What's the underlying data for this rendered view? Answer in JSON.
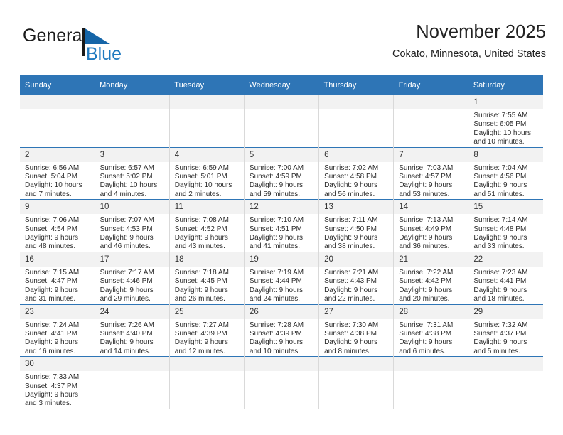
{
  "brand": {
    "name_line1": "General",
    "name_line2": "Blue",
    "logo_icon": "blue-triangle-flag-icon",
    "color_dark": "#1a1a1a",
    "color_blue": "#1f7ac0"
  },
  "header": {
    "title": "November 2025",
    "subtitle": "Cokato, Minnesota, United States"
  },
  "theme": {
    "header_bar": "#2e75b6",
    "date_band": "#f2f2f2",
    "row_divider": "#2e75b6",
    "cell_divider": "#d9d9d9"
  },
  "weekday_headers": [
    "Sunday",
    "Monday",
    "Tuesday",
    "Wednesday",
    "Thursday",
    "Friday",
    "Saturday"
  ],
  "weeks": [
    [
      {
        "day": "",
        "empty": true
      },
      {
        "day": "",
        "empty": true
      },
      {
        "day": "",
        "empty": true
      },
      {
        "day": "",
        "empty": true
      },
      {
        "day": "",
        "empty": true
      },
      {
        "day": "",
        "empty": true
      },
      {
        "day": "1",
        "sunrise": "Sunrise: 7:55 AM",
        "sunset": "Sunset: 6:05 PM",
        "daylight1": "Daylight: 10 hours",
        "daylight2": "and 10 minutes."
      }
    ],
    [
      {
        "day": "2",
        "sunrise": "Sunrise: 6:56 AM",
        "sunset": "Sunset: 5:04 PM",
        "daylight1": "Daylight: 10 hours",
        "daylight2": "and 7 minutes."
      },
      {
        "day": "3",
        "sunrise": "Sunrise: 6:57 AM",
        "sunset": "Sunset: 5:02 PM",
        "daylight1": "Daylight: 10 hours",
        "daylight2": "and 4 minutes."
      },
      {
        "day": "4",
        "sunrise": "Sunrise: 6:59 AM",
        "sunset": "Sunset: 5:01 PM",
        "daylight1": "Daylight: 10 hours",
        "daylight2": "and 2 minutes."
      },
      {
        "day": "5",
        "sunrise": "Sunrise: 7:00 AM",
        "sunset": "Sunset: 4:59 PM",
        "daylight1": "Daylight: 9 hours",
        "daylight2": "and 59 minutes."
      },
      {
        "day": "6",
        "sunrise": "Sunrise: 7:02 AM",
        "sunset": "Sunset: 4:58 PM",
        "daylight1": "Daylight: 9 hours",
        "daylight2": "and 56 minutes."
      },
      {
        "day": "7",
        "sunrise": "Sunrise: 7:03 AM",
        "sunset": "Sunset: 4:57 PM",
        "daylight1": "Daylight: 9 hours",
        "daylight2": "and 53 minutes."
      },
      {
        "day": "8",
        "sunrise": "Sunrise: 7:04 AM",
        "sunset": "Sunset: 4:56 PM",
        "daylight1": "Daylight: 9 hours",
        "daylight2": "and 51 minutes."
      }
    ],
    [
      {
        "day": "9",
        "sunrise": "Sunrise: 7:06 AM",
        "sunset": "Sunset: 4:54 PM",
        "daylight1": "Daylight: 9 hours",
        "daylight2": "and 48 minutes."
      },
      {
        "day": "10",
        "sunrise": "Sunrise: 7:07 AM",
        "sunset": "Sunset: 4:53 PM",
        "daylight1": "Daylight: 9 hours",
        "daylight2": "and 46 minutes."
      },
      {
        "day": "11",
        "sunrise": "Sunrise: 7:08 AM",
        "sunset": "Sunset: 4:52 PM",
        "daylight1": "Daylight: 9 hours",
        "daylight2": "and 43 minutes."
      },
      {
        "day": "12",
        "sunrise": "Sunrise: 7:10 AM",
        "sunset": "Sunset: 4:51 PM",
        "daylight1": "Daylight: 9 hours",
        "daylight2": "and 41 minutes."
      },
      {
        "day": "13",
        "sunrise": "Sunrise: 7:11 AM",
        "sunset": "Sunset: 4:50 PM",
        "daylight1": "Daylight: 9 hours",
        "daylight2": "and 38 minutes."
      },
      {
        "day": "14",
        "sunrise": "Sunrise: 7:13 AM",
        "sunset": "Sunset: 4:49 PM",
        "daylight1": "Daylight: 9 hours",
        "daylight2": "and 36 minutes."
      },
      {
        "day": "15",
        "sunrise": "Sunrise: 7:14 AM",
        "sunset": "Sunset: 4:48 PM",
        "daylight1": "Daylight: 9 hours",
        "daylight2": "and 33 minutes."
      }
    ],
    [
      {
        "day": "16",
        "sunrise": "Sunrise: 7:15 AM",
        "sunset": "Sunset: 4:47 PM",
        "daylight1": "Daylight: 9 hours",
        "daylight2": "and 31 minutes."
      },
      {
        "day": "17",
        "sunrise": "Sunrise: 7:17 AM",
        "sunset": "Sunset: 4:46 PM",
        "daylight1": "Daylight: 9 hours",
        "daylight2": "and 29 minutes."
      },
      {
        "day": "18",
        "sunrise": "Sunrise: 7:18 AM",
        "sunset": "Sunset: 4:45 PM",
        "daylight1": "Daylight: 9 hours",
        "daylight2": "and 26 minutes."
      },
      {
        "day": "19",
        "sunrise": "Sunrise: 7:19 AM",
        "sunset": "Sunset: 4:44 PM",
        "daylight1": "Daylight: 9 hours",
        "daylight2": "and 24 minutes."
      },
      {
        "day": "20",
        "sunrise": "Sunrise: 7:21 AM",
        "sunset": "Sunset: 4:43 PM",
        "daylight1": "Daylight: 9 hours",
        "daylight2": "and 22 minutes."
      },
      {
        "day": "21",
        "sunrise": "Sunrise: 7:22 AM",
        "sunset": "Sunset: 4:42 PM",
        "daylight1": "Daylight: 9 hours",
        "daylight2": "and 20 minutes."
      },
      {
        "day": "22",
        "sunrise": "Sunrise: 7:23 AM",
        "sunset": "Sunset: 4:41 PM",
        "daylight1": "Daylight: 9 hours",
        "daylight2": "and 18 minutes."
      }
    ],
    [
      {
        "day": "23",
        "sunrise": "Sunrise: 7:24 AM",
        "sunset": "Sunset: 4:41 PM",
        "daylight1": "Daylight: 9 hours",
        "daylight2": "and 16 minutes."
      },
      {
        "day": "24",
        "sunrise": "Sunrise: 7:26 AM",
        "sunset": "Sunset: 4:40 PM",
        "daylight1": "Daylight: 9 hours",
        "daylight2": "and 14 minutes."
      },
      {
        "day": "25",
        "sunrise": "Sunrise: 7:27 AM",
        "sunset": "Sunset: 4:39 PM",
        "daylight1": "Daylight: 9 hours",
        "daylight2": "and 12 minutes."
      },
      {
        "day": "26",
        "sunrise": "Sunrise: 7:28 AM",
        "sunset": "Sunset: 4:39 PM",
        "daylight1": "Daylight: 9 hours",
        "daylight2": "and 10 minutes."
      },
      {
        "day": "27",
        "sunrise": "Sunrise: 7:30 AM",
        "sunset": "Sunset: 4:38 PM",
        "daylight1": "Daylight: 9 hours",
        "daylight2": "and 8 minutes."
      },
      {
        "day": "28",
        "sunrise": "Sunrise: 7:31 AM",
        "sunset": "Sunset: 4:38 PM",
        "daylight1": "Daylight: 9 hours",
        "daylight2": "and 6 minutes."
      },
      {
        "day": "29",
        "sunrise": "Sunrise: 7:32 AM",
        "sunset": "Sunset: 4:37 PM",
        "daylight1": "Daylight: 9 hours",
        "daylight2": "and 5 minutes."
      }
    ],
    [
      {
        "day": "30",
        "sunrise": "Sunrise: 7:33 AM",
        "sunset": "Sunset: 4:37 PM",
        "daylight1": "Daylight: 9 hours",
        "daylight2": "and 3 minutes."
      },
      {
        "day": "",
        "empty": true
      },
      {
        "day": "",
        "empty": true
      },
      {
        "day": "",
        "empty": true
      },
      {
        "day": "",
        "empty": true
      },
      {
        "day": "",
        "empty": true
      },
      {
        "day": "",
        "empty": true
      }
    ]
  ]
}
